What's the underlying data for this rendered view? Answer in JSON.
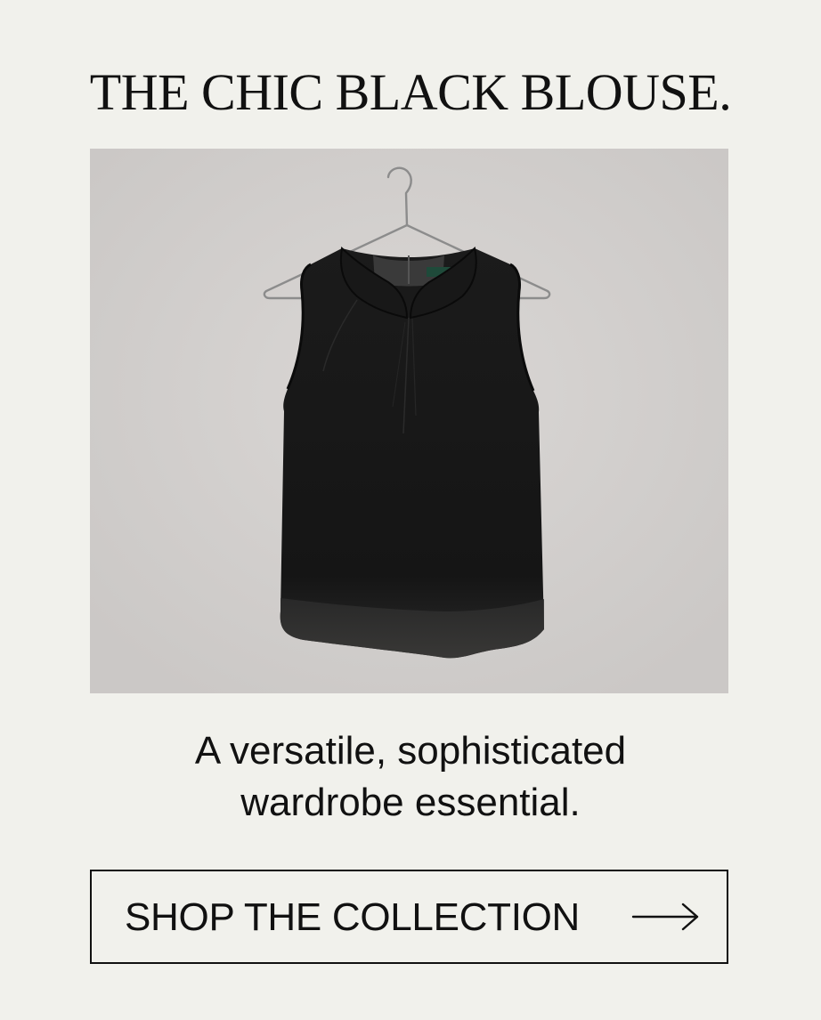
{
  "headline": "THE CHIC BLACK BLOUSE.",
  "product_image": {
    "label_text": "&amp;",
    "colors": {
      "backdrop": "#d4d1cf",
      "garment": "#141414",
      "hanger": "#8a8a8a",
      "label": "#1f4a3a"
    }
  },
  "subtitle": {
    "line1": "A versatile, sophisticated",
    "line2": "wardrobe essential."
  },
  "cta": {
    "label": "SHOP THE COLLECTION",
    "icon": "arrow-right-icon"
  }
}
